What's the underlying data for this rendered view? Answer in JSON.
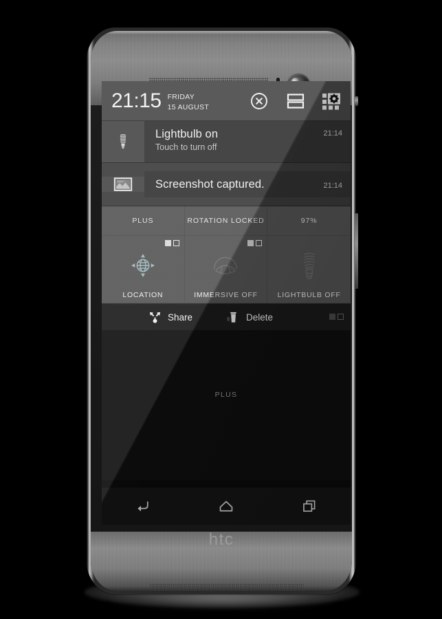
{
  "device": {
    "brand_logo": "htc",
    "front_camera_icon": "front-camera-icon",
    "proximity_sensor_icon": "proximity-sensor-icon",
    "top_speaker_icon": "speaker-grille-icon",
    "bottom_speaker_icon": "speaker-grille-icon",
    "power_button_icon": "power-button-icon",
    "volume_button_icon": "volume-button-icon"
  },
  "colors": {
    "header_bg": "#4a4a4a",
    "notification_bg": "#343434",
    "notification_icon_bg": "#484848",
    "tile_bg": "#565656",
    "actionbar_bg": "#1b1b1b",
    "screen_bg": "#0f0f0f",
    "navbar_bg": "#151515",
    "accent_text": "#f1f1f1",
    "tile_icon_active": "#9fb8bd",
    "tile_icon_inactive": "#6e6e6e"
  },
  "shade": {
    "header": {
      "clock": "21:15",
      "day": "FRIDAY",
      "date": "15 AUGUST",
      "clear_all_icon": "clear-all-icon",
      "cards_toggle_icon": "cards-layout-icon",
      "quick_settings_icon": "quick-settings-grid-icon"
    },
    "notifications": [
      {
        "icon": "lightbulb-icon",
        "title": "Lightbulb on",
        "subtitle": "Touch to turn off",
        "time": "21:14"
      },
      {
        "icon": "screenshot-thumbnail-icon",
        "title": "Screenshot captured.",
        "subtitle": "",
        "time": "21:14"
      }
    ],
    "status_tiles": [
      {
        "label": "PLUS"
      },
      {
        "label": "ROTATION LOCKED"
      },
      {
        "label": "97%"
      }
    ],
    "toggle_tiles": [
      {
        "label": "LOCATION",
        "icon": "location-globe-icon",
        "state": "on",
        "switch_icon": "mini-switch-icon"
      },
      {
        "label": "IMMERSIVE OFF",
        "icon": "immersive-fan-icon",
        "state": "off",
        "switch_icon": "mini-switch-icon"
      },
      {
        "label": "LIGHTBULB OFF",
        "icon": "lightbulb-icon",
        "state": "off",
        "switch_icon": ""
      }
    ],
    "actions": {
      "share_label": "Share",
      "share_icon": "share-icon",
      "delete_label": "Delete",
      "delete_icon": "trash-icon",
      "mini_switch_icon": "mini-switch-icon"
    },
    "footer_label": "PLUS"
  },
  "navbar": {
    "back_icon": "back-arrow-icon",
    "home_icon": "home-icon",
    "recents_icon": "recent-apps-icon"
  }
}
